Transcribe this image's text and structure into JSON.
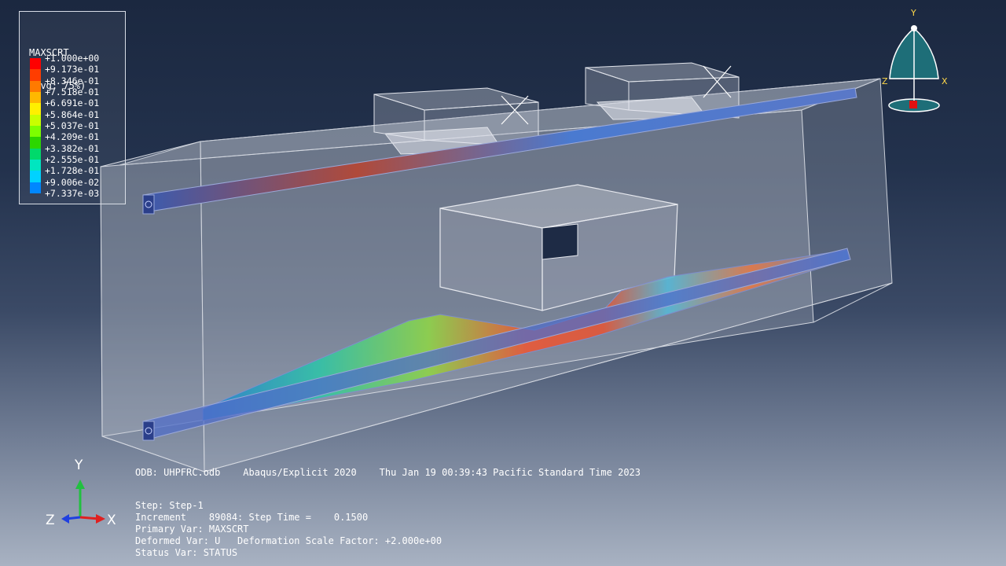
{
  "legend": {
    "variable": "MAXSCRT",
    "averaging": "(Avg: 75%)",
    "levels": [
      {
        "label": "+1.000e+00",
        "color": "#ff0000"
      },
      {
        "label": "+9.173e-01",
        "color": "#ff3d00"
      },
      {
        "label": "+8.346e-01",
        "color": "#ff7a00"
      },
      {
        "label": "+7.518e-01",
        "color": "#ffb800"
      },
      {
        "label": "+6.691e-01",
        "color": "#fff000"
      },
      {
        "label": "+5.864e-01",
        "color": "#c8ff00"
      },
      {
        "label": "+5.037e-01",
        "color": "#7dff00"
      },
      {
        "label": "+4.209e-01",
        "color": "#2cd600"
      },
      {
        "label": "+3.382e-01",
        "color": "#00d96b"
      },
      {
        "label": "+2.555e-01",
        "color": "#00e6c0"
      },
      {
        "label": "+1.728e-01",
        "color": "#00d2ff"
      },
      {
        "label": "+9.006e-02",
        "color": "#0087ff"
      },
      {
        "label": "+7.337e-03",
        "color": "#0020ff"
      }
    ]
  },
  "info": {
    "odb_line": "ODB: UHPFRC.odb    Abaqus/Explicit 2020    Thu Jan 19 00:39:43 Pacific Standard Time 2023",
    "step": "Step: Step-1",
    "increment": "Increment    89084: Step Time =    0.1500",
    "primary_var": "Primary Var: MAXSCRT",
    "deformed_var": "Deformed Var: U   Deformation Scale Factor: +2.000e+00",
    "status_var": "Status Var: STATUS"
  },
  "triad": {
    "y_label": "Y",
    "z_label": "Z",
    "x_label": "X"
  },
  "view_cube": {
    "y_label": "Y",
    "z_label": "Z",
    "x_label": "X"
  }
}
